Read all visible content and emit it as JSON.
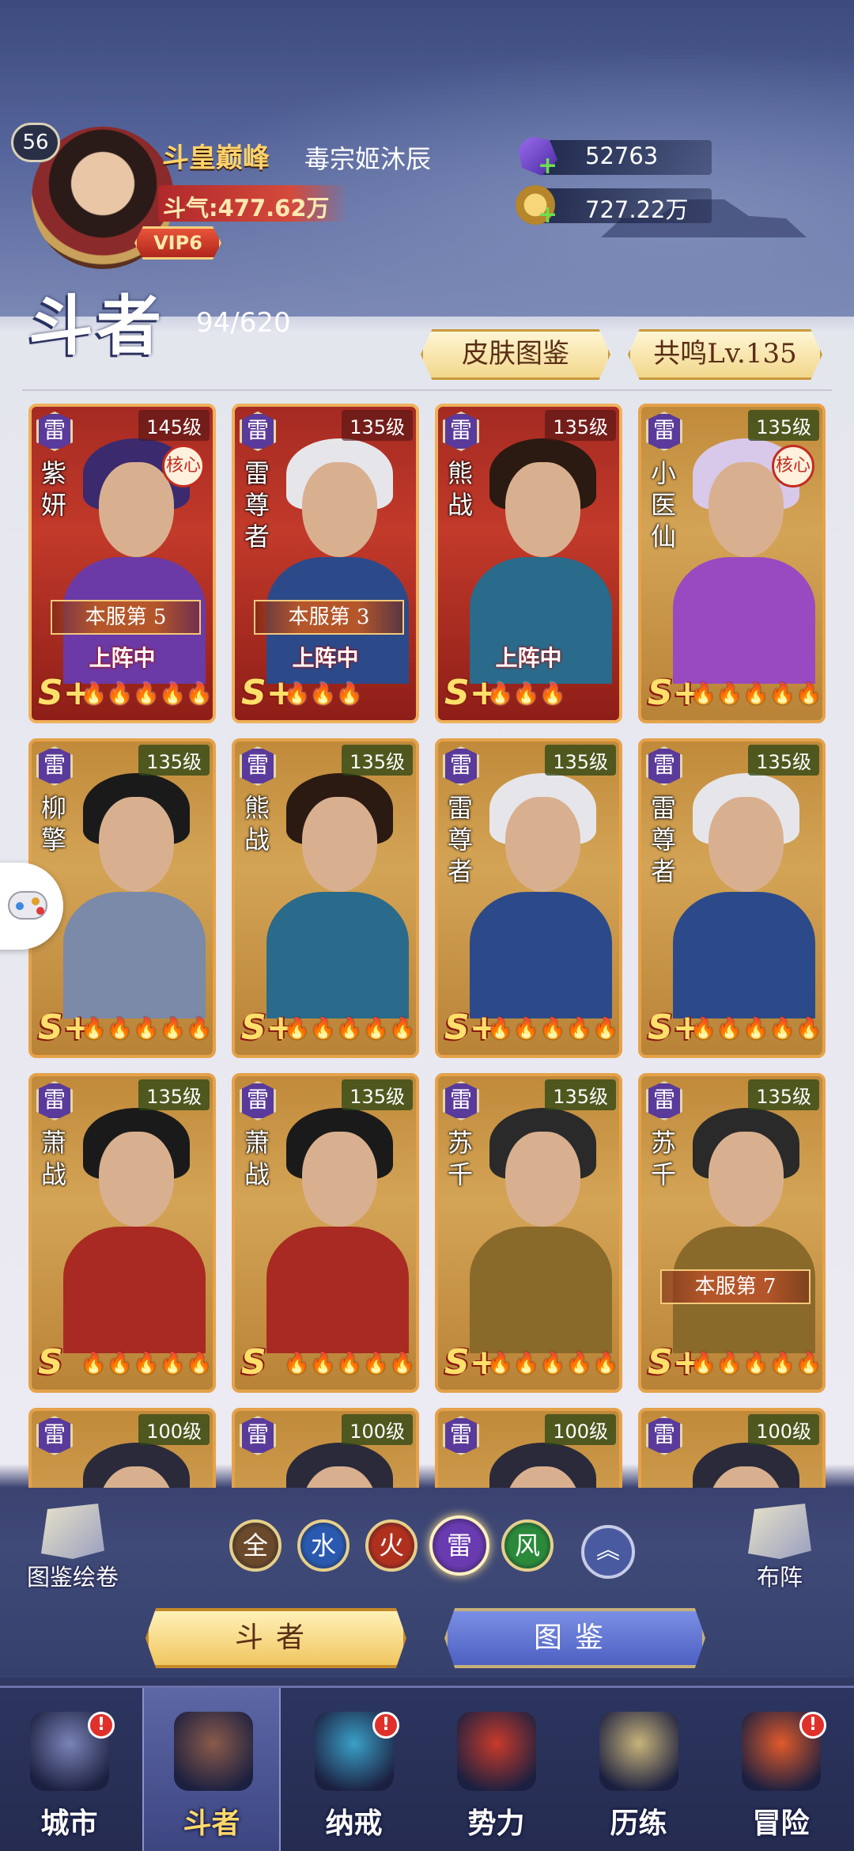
{
  "player": {
    "level": "56",
    "title": "斗皇巅峰",
    "name": "毒宗姬沐辰",
    "power": "斗气:477.62万",
    "vip": "VIP6"
  },
  "resources": {
    "crystal": "52763",
    "coin": "727.22万"
  },
  "section": {
    "title": "斗者",
    "count": "94/620"
  },
  "buttons": {
    "skin_atlas": "皮肤图鉴",
    "resonance": "共鸣Lv.135"
  },
  "heroes": [
    {
      "element": "雷",
      "level": "145级",
      "name": "紫妍",
      "core": "核心",
      "rank": "本服第 5",
      "status": "上阵中",
      "grade": "S+",
      "stars": "🔥🔥🔥🔥🔥",
      "theme": "red",
      "hair": "#3b2a6e",
      "body": "#6b3aa6"
    },
    {
      "element": "雷",
      "level": "135级",
      "name": "雷尊者",
      "rank": "本服第 3",
      "status": "上阵中",
      "grade": "S+",
      "stars": "🔥🔥🔥",
      "theme": "red",
      "hair": "#e6e6ea",
      "body": "#2c4a8a"
    },
    {
      "element": "雷",
      "level": "135级",
      "name": "熊战",
      "status": "上阵中",
      "grade": "S+",
      "stars": "🔥🔥🔥",
      "theme": "red",
      "hair": "#2a1a12",
      "body": "#2a6a8a"
    },
    {
      "element": "雷",
      "level": "135级",
      "name": "小医仙",
      "core": "核心",
      "grade": "S+",
      "stars": "🔥🔥🔥🔥🔥",
      "theme": "gold",
      "hair": "#d8c8ea",
      "body": "#9a4ac0"
    },
    {
      "element": "雷",
      "level": "135级",
      "name": "柳擎",
      "grade": "S+",
      "stars": "🔥🔥🔥🔥🔥",
      "theme": "gold",
      "hair": "#1a1a1a",
      "body": "#7a8aa8"
    },
    {
      "element": "雷",
      "level": "135级",
      "name": "熊战",
      "grade": "S+",
      "stars": "🔥🔥🔥🔥🔥",
      "theme": "gold",
      "hair": "#2a1a12",
      "body": "#2a6a8a"
    },
    {
      "element": "雷",
      "level": "135级",
      "name": "雷尊者",
      "grade": "S+",
      "stars": "🔥🔥🔥🔥🔥",
      "theme": "gold",
      "hair": "#e6e6ea",
      "body": "#2c4a8a"
    },
    {
      "element": "雷",
      "level": "135级",
      "name": "雷尊者",
      "grade": "S+",
      "stars": "🔥🔥🔥🔥🔥",
      "theme": "gold",
      "hair": "#e6e6ea",
      "body": "#2c4a8a"
    },
    {
      "element": "雷",
      "level": "135级",
      "name": "萧战",
      "grade": "S",
      "stars": "🔥🔥🔥🔥🔥",
      "theme": "gold",
      "hair": "#1a1a1a",
      "body": "#a82a22"
    },
    {
      "element": "雷",
      "level": "135级",
      "name": "萧战",
      "grade": "S",
      "stars": "🔥🔥🔥🔥🔥",
      "theme": "gold",
      "hair": "#1a1a1a",
      "body": "#a82a22"
    },
    {
      "element": "雷",
      "level": "135级",
      "name": "苏千",
      "grade": "S+",
      "stars": "🔥🔥🔥🔥🔥",
      "theme": "gold",
      "hair": "#2a2a2a",
      "body": "#8a6a2a"
    },
    {
      "element": "雷",
      "level": "135级",
      "name": "苏千",
      "rank": "本服第 7",
      "grade": "S+",
      "stars": "🔥🔥🔥🔥🔥",
      "theme": "gold",
      "hair": "#2a2a2a",
      "body": "#8a6a2a"
    },
    {
      "element": "雷",
      "level": "100级",
      "name": "",
      "grade": "",
      "stars": "",
      "theme": "gold",
      "hair": "#2a2a3a",
      "body": "#3a3a4a"
    },
    {
      "element": "雷",
      "level": "100级",
      "name": "",
      "grade": "",
      "stars": "",
      "theme": "gold",
      "hair": "#2a2a3a",
      "body": "#3a3a4a"
    },
    {
      "element": "雷",
      "level": "100级",
      "name": "",
      "grade": "",
      "stars": "",
      "theme": "gold",
      "hair": "#2a2a3a",
      "body": "#3a3a4a"
    },
    {
      "element": "雷",
      "level": "100级",
      "name": "",
      "grade": "",
      "stars": "",
      "theme": "gold",
      "hair": "#2a2a3a",
      "body": "#3a3a4a"
    }
  ],
  "controls": {
    "atlas_scroll": "图鉴绘卷",
    "lineup": "布阵",
    "tab_fighter": "斗者",
    "tab_atlas": "图鉴"
  },
  "filters": [
    {
      "label": "全",
      "color": "#6a4a2a",
      "active": false
    },
    {
      "label": "水",
      "color": "#2a5ab0",
      "active": false
    },
    {
      "label": "火",
      "color": "#b0301e",
      "active": false
    },
    {
      "label": "雷",
      "color": "#6a3ab0",
      "active": true
    },
    {
      "label": "风",
      "color": "#2a8a3a",
      "active": false
    }
  ],
  "nav": [
    {
      "label": "城市",
      "alert": "!",
      "active": false,
      "icon_color": "#7a84b8"
    },
    {
      "label": "斗者",
      "active": true,
      "icon_color": "#8a5a4a"
    },
    {
      "label": "纳戒",
      "alert": "!",
      "active": false,
      "icon_color": "#3aa0c8"
    },
    {
      "label": "势力",
      "active": false,
      "icon_color": "#c83a2a"
    },
    {
      "label": "历练",
      "active": false,
      "icon_color": "#c8b47a"
    },
    {
      "label": "冒险",
      "alert": "!",
      "active": false,
      "icon_color": "#e05a2a"
    }
  ]
}
